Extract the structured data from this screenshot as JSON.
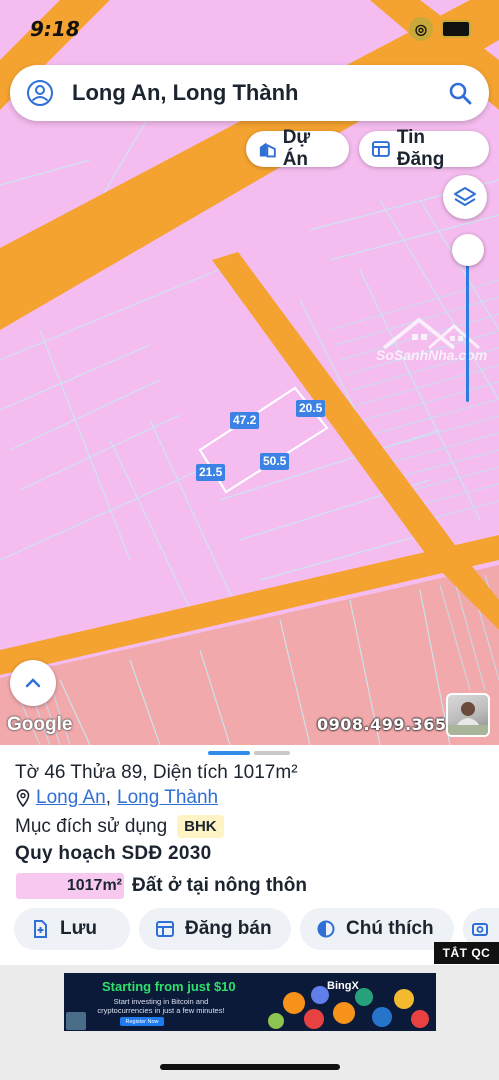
{
  "status": {
    "time": "9:18"
  },
  "search": {
    "title": "Long An, Long Thành"
  },
  "chips": {
    "project": "Dự Án",
    "listings": "Tin Đăng"
  },
  "watermark": {
    "text": "SoSanhNha.com"
  },
  "parcel": {
    "dims": [
      "47.2",
      "20.5",
      "21.5",
      "50.5"
    ]
  },
  "map": {
    "google": "Google",
    "phone": "0908.499.365"
  },
  "sheet": {
    "title": "Tờ 46 Thửa 89, Diện tích 1017m²",
    "province": "Long An",
    "separator": ",",
    "district": "Long Thành",
    "purpose_label": "Mục đích sử dụng",
    "purpose_code": "BHK",
    "plan_title": "Quy hoạch SDĐ 2030",
    "area": "1017m²",
    "land_use": "Đất ở tại nông thôn"
  },
  "actions": {
    "save": "Lưu",
    "sell": "Đăng bán",
    "legend": "Chú thích"
  },
  "ad": {
    "close": "TẮT QC",
    "headline": "Starting from just $10",
    "sub": "Start investing in Bitcoin and cryptocurrencies in just a few minutes!",
    "register": "Register Now",
    "brand": "BingX"
  },
  "colors": {
    "land": "#f4b8ee",
    "road": "#f4a330",
    "agri": "#f4aaa8",
    "accent": "#2f6fd6",
    "dim": "#3b82e4"
  }
}
